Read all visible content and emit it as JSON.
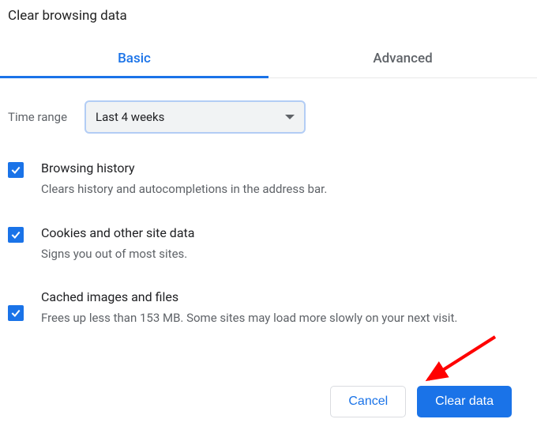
{
  "title": "Clear browsing data",
  "tabs": {
    "basic": "Basic",
    "advanced": "Advanced"
  },
  "time_range": {
    "label": "Time range",
    "value": "Last 4 weeks"
  },
  "options": [
    {
      "title": "Browsing history",
      "desc": "Clears history and autocompletions in the address bar."
    },
    {
      "title": "Cookies and other site data",
      "desc": "Signs you out of most sites."
    },
    {
      "title": "Cached images and files",
      "desc": "Frees up less than 153 MB. Some sites may load more slowly on your next visit."
    }
  ],
  "buttons": {
    "cancel": "Cancel",
    "clear": "Clear data"
  }
}
